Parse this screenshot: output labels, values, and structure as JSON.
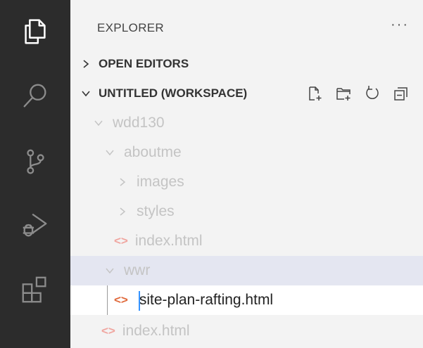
{
  "explorer": {
    "title": "EXPLORER",
    "more": "···"
  },
  "sections": {
    "open_editors": "OPEN EDITORS",
    "workspace": "UNTITLED (WORKSPACE)"
  },
  "tree": {
    "wdd130": "wdd130",
    "aboutme": "aboutme",
    "images": "images",
    "styles": "styles",
    "aboutme_index": "index.html",
    "wwr": "wwr",
    "site_plan": "site-plan-rafting.html",
    "root_index": "index.html"
  },
  "icons": {
    "html_glyph": "<>"
  },
  "colors": {
    "activity_bar": "#2c2c2c",
    "sidebar": "#f3f3f3",
    "selection": "#ffffff",
    "cursor": "#3794ff",
    "html_icon": "#e0693b"
  }
}
